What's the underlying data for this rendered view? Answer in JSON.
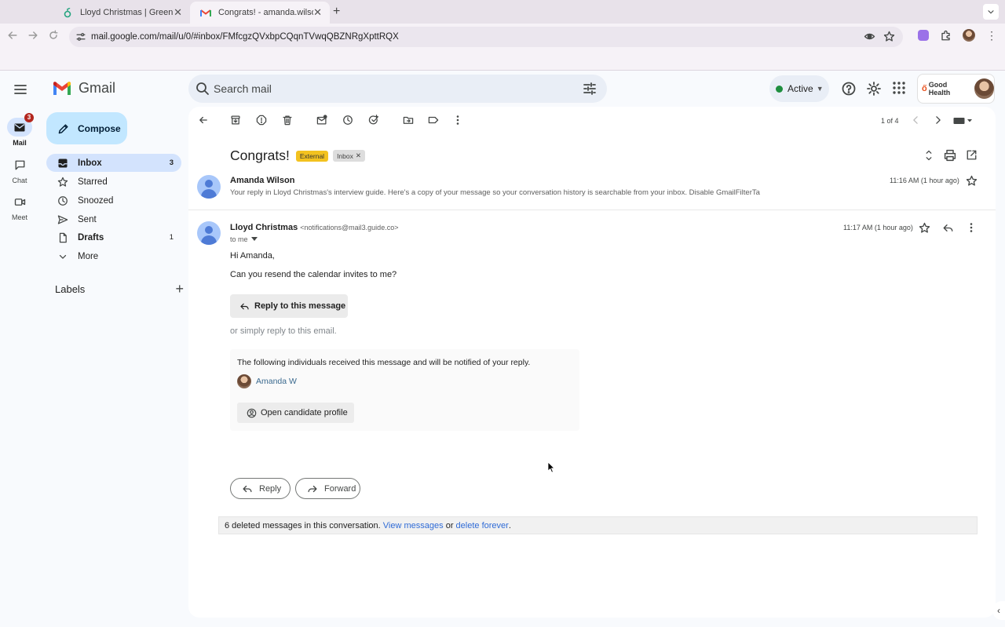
{
  "browser": {
    "tabs": [
      {
        "title": "Lloyd Christmas | Greenhouse",
        "favicon": "greenhouse-sprout-icon",
        "active": false
      },
      {
        "title": "Congrats! - amanda.wilson@",
        "favicon": "gmail-icon",
        "active": true
      }
    ],
    "url": "mail.google.com/mail/u/0/#inbox/FMfcgzQVxbpCQqnTVwqQBZNRgXpttRQX"
  },
  "gmail": {
    "logo_text": "Gmail",
    "search_placeholder": "Search mail",
    "status": "Active",
    "account_brand": "Good Health",
    "rail": [
      {
        "label": "Mail",
        "badge": "3",
        "icon": "mail-icon"
      },
      {
        "label": "Chat",
        "icon": "chat-icon"
      },
      {
        "label": "Meet",
        "icon": "video-icon"
      }
    ],
    "compose_label": "Compose",
    "nav": [
      {
        "label": "Inbox",
        "count": "3",
        "icon": "inbox-icon"
      },
      {
        "label": "Starred",
        "count": "",
        "icon": "star-icon"
      },
      {
        "label": "Snoozed",
        "count": "",
        "icon": "clock-icon"
      },
      {
        "label": "Sent",
        "count": "",
        "icon": "send-icon"
      },
      {
        "label": "Drafts",
        "count": "1",
        "icon": "draft-icon"
      },
      {
        "label": "More",
        "count": "",
        "icon": "chevron-down-icon"
      }
    ],
    "labels_heading": "Labels",
    "pager": "1 of 4"
  },
  "thread": {
    "subject": "Congrats!",
    "chips": {
      "external": "External",
      "inbox": "Inbox"
    },
    "messages": [
      {
        "sender": "Amanda Wilson",
        "snippet": "Your reply in Lloyd Christmas's interview guide. Here's a copy of your message so your conversation history is searchable from your inbox. Disable GmailFilterTa",
        "time": "11:16 AM (1 hour ago)"
      },
      {
        "sender": "Lloyd Christmas",
        "email": "<notifications@mail3.guide.co>",
        "to": "to me",
        "time": "11:17 AM (1 hour ago)",
        "greeting": "Hi Amanda,",
        "body": "Can you resend the calendar invites to me?",
        "reply_button": "Reply to this message",
        "or_simply": "or simply reply to this email.",
        "notify_text": "The following individuals received this message and will be notified of your reply.",
        "recipient": "Amanda W",
        "profile_button": "Open candidate profile"
      }
    ],
    "reply_label": "Reply",
    "forward_label": "Forward",
    "deleted": {
      "prefix": "6 deleted messages in this conversation.",
      "view_link": "View messages",
      "or": "or",
      "delete_link": "delete forever",
      "suffix": "."
    }
  }
}
